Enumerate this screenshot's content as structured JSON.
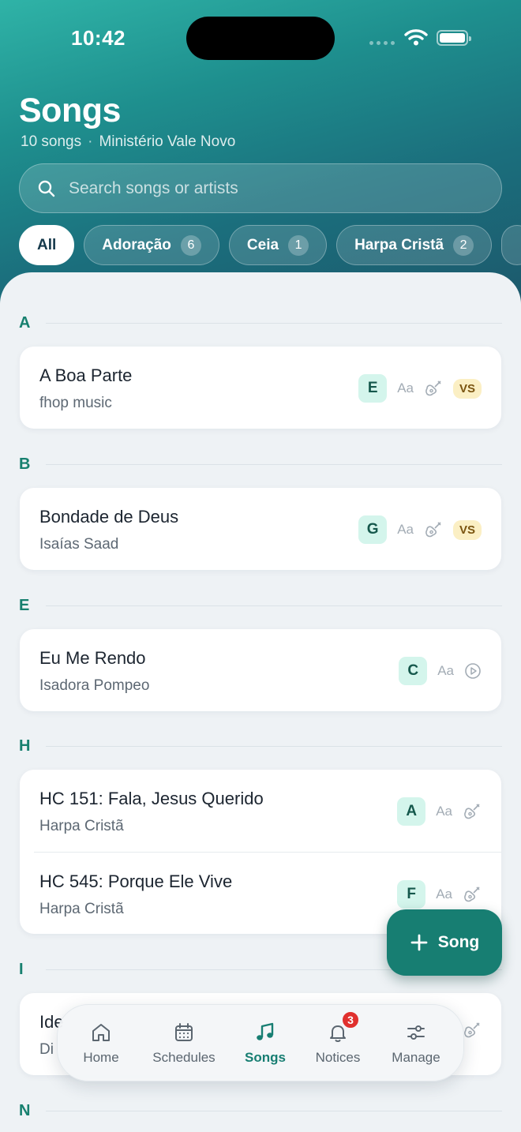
{
  "status": {
    "time": "10:42"
  },
  "header": {
    "title": "Songs",
    "song_count": "10 songs",
    "separator": "·",
    "ministry": "Ministério Vale Novo"
  },
  "search": {
    "placeholder": "Search songs or artists",
    "value": ""
  },
  "chips": [
    {
      "label": "All",
      "count": ""
    },
    {
      "label": "Adoração",
      "count": "6"
    },
    {
      "label": "Ceia",
      "count": "1"
    },
    {
      "label": "Harpa Cristã",
      "count": "2"
    }
  ],
  "sections": [
    {
      "letter": "A",
      "songs": [
        {
          "title": "A Boa Parte",
          "artist": "fhop music",
          "key": "E",
          "lyrics_label": "Aa",
          "badge": "VS"
        }
      ]
    },
    {
      "letter": "B",
      "songs": [
        {
          "title": "Bondade de Deus",
          "artist": "Isaías Saad",
          "key": "G",
          "lyrics_label": "Aa",
          "badge": "VS"
        }
      ]
    },
    {
      "letter": "E",
      "songs": [
        {
          "title": "Eu Me Rendo",
          "artist": "Isadora Pompeo",
          "key": "C",
          "lyrics_label": "Aa"
        }
      ]
    },
    {
      "letter": "H",
      "songs": [
        {
          "title": "HC 151: Fala, Jesus Querido",
          "artist": "Harpa Cristã",
          "key": "A",
          "lyrics_label": "Aa"
        },
        {
          "title": "HC 545: Porque Ele Vive",
          "artist": "Harpa Cristã",
          "key": "F",
          "lyrics_label": "Aa"
        }
      ]
    },
    {
      "letter": "I",
      "songs": [
        {
          "title": "Ide",
          "artist": "Di"
        }
      ]
    },
    {
      "letter": "N",
      "songs": []
    }
  ],
  "fab": {
    "label": "Song"
  },
  "nav": {
    "items": [
      {
        "label": "Home",
        "icon": "home-icon"
      },
      {
        "label": "Schedules",
        "icon": "calendar-icon"
      },
      {
        "label": "Songs",
        "icon": "music-note-icon"
      },
      {
        "label": "Notices",
        "icon": "bell-icon",
        "badge": "3"
      },
      {
        "label": "Manage",
        "icon": "sliders-icon"
      }
    ]
  },
  "colors": {
    "accent": "#177e72",
    "key_bg": "#d4f5ec",
    "vs_bg": "#fbefc4",
    "badge_red": "#e0302e"
  }
}
